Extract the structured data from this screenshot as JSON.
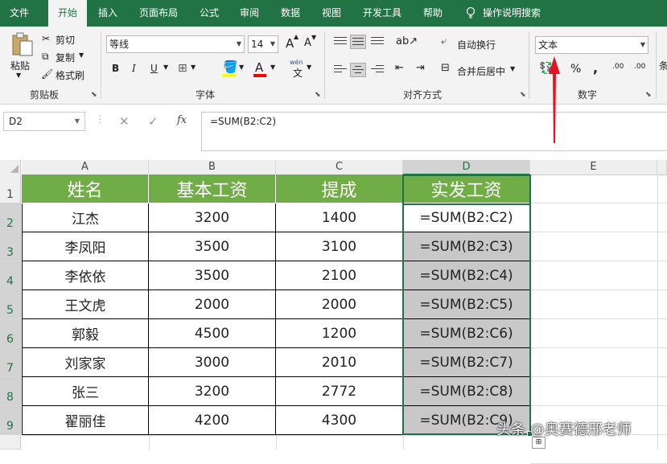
{
  "menu": {
    "tabs": [
      "文件",
      "开始",
      "插入",
      "页面布局",
      "公式",
      "审阅",
      "数据",
      "视图",
      "开发工具",
      "帮助"
    ],
    "tell_me": "操作说明搜索"
  },
  "ribbon": {
    "clipboard": {
      "paste": "粘贴",
      "cut": "剪切",
      "copy": "复制",
      "format_painter": "格式刷",
      "label": "剪贴板"
    },
    "font": {
      "name": "等线",
      "size": "14",
      "bold": "B",
      "italic": "I",
      "underline": "U",
      "label": "字体",
      "grow": "A",
      "shrink": "A",
      "color_a": "A",
      "phonetic": "wén"
    },
    "alignment": {
      "wrap": "自动换行",
      "merge": "合并后居中",
      "label": "对齐方式"
    },
    "number": {
      "format": "文本",
      "percent": "%",
      "comma": ",",
      "inc_dec": ".00",
      "dec_dec": ".00",
      "label": "数字"
    },
    "edge_text": "条"
  },
  "formula_bar": {
    "name_box": "D2",
    "fx": "fx",
    "formula": "=SUM(B2:C2)"
  },
  "columns": [
    "A",
    "B",
    "C",
    "D",
    "E"
  ],
  "rows": [
    "1",
    "2",
    "3",
    "4",
    "5",
    "6",
    "7",
    "8",
    "9"
  ],
  "table": {
    "headers": [
      "姓名",
      "基本工资",
      "提成",
      "实发工资"
    ],
    "rows": [
      [
        "江杰",
        "3200",
        "1400",
        "=SUM(B2:C2)"
      ],
      [
        "李凤阳",
        "3500",
        "3100",
        "=SUM(B2:C3)"
      ],
      [
        "李依依",
        "3500",
        "2100",
        "=SUM(B2:C4)"
      ],
      [
        "王文虎",
        "2000",
        "2000",
        "=SUM(B2:C5)"
      ],
      [
        "郭毅",
        "4500",
        "1200",
        "=SUM(B2:C6)"
      ],
      [
        "刘家家",
        "3000",
        "2010",
        "=SUM(B2:C7)"
      ],
      [
        "张三",
        "3200",
        "2772",
        "=SUM(B2:C8)"
      ],
      [
        "翟丽佳",
        "4200",
        "4300",
        "=SUM(B2:C9)"
      ]
    ]
  },
  "watermark": "头条 @奥赛德邢老师",
  "colors": {
    "excel_green": "#217346",
    "header_fill": "#70ad47",
    "annotation_red": "#e81123"
  }
}
